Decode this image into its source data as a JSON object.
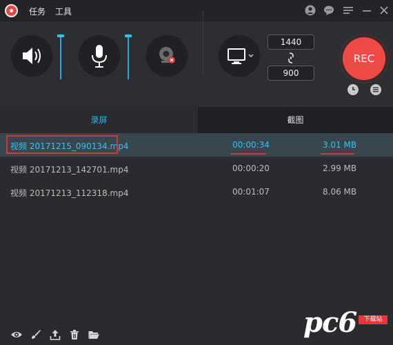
{
  "menu": {
    "task": "任务",
    "tools": "工具"
  },
  "toolbar": {
    "width": "1440",
    "height": "900",
    "rec_label": "REC",
    "speaker_level": 0.95,
    "mic_level": 0.95
  },
  "tabs": {
    "record": "录屏",
    "screenshot": "截图"
  },
  "recordings": [
    {
      "name": "视频 20171215_090134.mp4",
      "duration": "00:00:34",
      "size": "3.01 MB"
    },
    {
      "name": "视频 20171213_142701.mp4",
      "duration": "00:00:20",
      "size": "2.99 MB"
    },
    {
      "name": "视频 20171213_112318.mp4",
      "duration": "00:01:07",
      "size": "8.06 MB"
    }
  ],
  "watermark": {
    "text": "pc6",
    "tag": "下载站"
  },
  "colors": {
    "accent": "#29b6ef",
    "rec": "#ef4a45",
    "highlight": "#d8363a",
    "selected_row": "#37474d"
  }
}
